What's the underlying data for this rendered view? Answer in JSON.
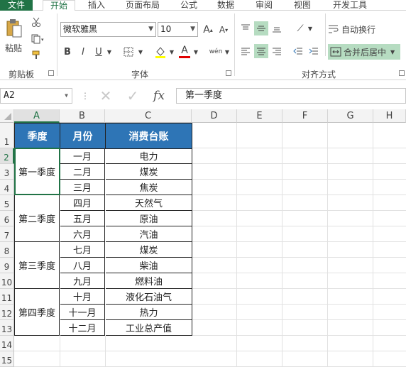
{
  "tabs": {
    "file": "文件",
    "home": "开始",
    "insert": "插入",
    "layout": "页面布局",
    "formulas": "公式",
    "data": "数据",
    "review": "审阅",
    "view": "视图",
    "developer": "开发工具"
  },
  "ribbon": {
    "clipboard_label": "剪贴板",
    "paste_label": "粘贴",
    "font_group_label": "字体",
    "font_name": "微软雅黑",
    "font_size": "10",
    "bold": "B",
    "italic": "I",
    "underline": "U",
    "font_color": "A",
    "phonetic": "wén",
    "alignment_label": "对齐方式",
    "wrap_text": "自动换行",
    "merge_center": "合并后居中"
  },
  "formula_bar": {
    "name_box": "A2",
    "fx": "fx",
    "content": "第一季度"
  },
  "columns": [
    "A",
    "B",
    "C",
    "D",
    "E",
    "F",
    "G",
    "H"
  ],
  "rows": [
    "1",
    "2",
    "3",
    "4",
    "5",
    "6",
    "7",
    "8",
    "9",
    "10",
    "11",
    "12",
    "13",
    "14",
    "15"
  ],
  "table": {
    "headers": [
      "季度",
      "月份",
      "消费台账"
    ],
    "quarters": [
      "第一季度",
      "第二季度",
      "第三季度",
      "第四季度"
    ],
    "months": [
      "一月",
      "二月",
      "三月",
      "四月",
      "五月",
      "六月",
      "七月",
      "八月",
      "九月",
      "十月",
      "十一月",
      "十二月"
    ],
    "items": [
      "电力",
      "煤炭",
      "焦炭",
      "天然气",
      "原油",
      "汽油",
      "煤炭",
      "柴油",
      "燃料油",
      "液化石油气",
      "热力",
      "工业总产值"
    ]
  },
  "colors": {
    "accent": "#217346",
    "header_fill": "#2e75b6",
    "selected_button": "#b6dcc1"
  }
}
